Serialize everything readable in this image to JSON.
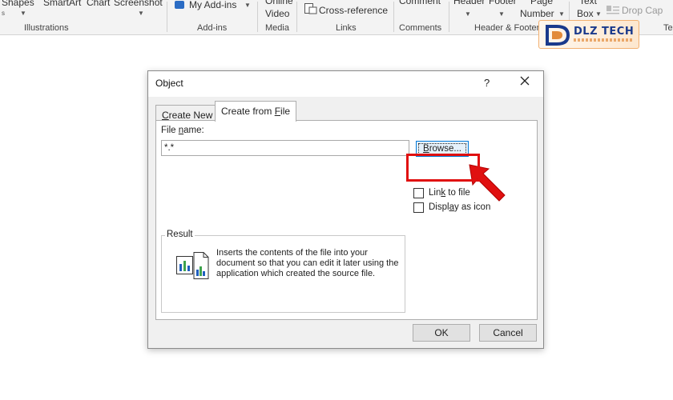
{
  "ribbon": {
    "row1": [
      "Shapes",
      "SmartArt",
      "Chart",
      "Screenshot"
    ],
    "addins": "My Add-ins",
    "online_top": "Online",
    "online_bottom": "Video",
    "cross_reference": "Cross-reference",
    "comment": "Comment",
    "header": "Header",
    "footer": "Footer",
    "page_top": "Page",
    "page_bottom": "Number",
    "text_top": "Text",
    "text_bottom": "Box",
    "drop_cap": "Drop Cap",
    "groups": {
      "illustrations": "Illustrations",
      "addins": "Add-ins",
      "media": "Media",
      "links": "Links",
      "comments": "Comments",
      "header_footer": "Header & Footer",
      "text_trunc": "Te"
    }
  },
  "logo": {
    "text": "DLZ TECH"
  },
  "dialog": {
    "title": "Object",
    "help": "?",
    "tabs": [
      {
        "pre": "",
        "key": "C",
        "post": "reate New"
      },
      {
        "pre": "Create from ",
        "key": "F",
        "post": "ile"
      }
    ],
    "file_name_label_pre": "File ",
    "file_name_label_key": "n",
    "file_name_label_post": "ame:",
    "file_name_value": "*.*",
    "browse": {
      "key": "B",
      "post": "rowse..."
    },
    "link_to_file": {
      "pre": "Lin",
      "key": "k",
      "post": " to file"
    },
    "display_as_icon": {
      "pre": "Displ",
      "key": "a",
      "post": "y as icon"
    },
    "result_label": "Result",
    "result_text": "Inserts the contents of the file into your document so that you can edit it later using the application which created the source file.",
    "ok": "OK",
    "cancel": "Cancel"
  },
  "colors": {
    "highlight": "#e01010",
    "arrow": "#e01010",
    "browse_border": "#0078d7"
  },
  "icons": [
    "close-icon",
    "object-file-icon",
    "pointer-arrow-icon",
    "caret-down-icon",
    "addins-icon",
    "cross-reference-icon",
    "drop-cap-icon"
  ]
}
